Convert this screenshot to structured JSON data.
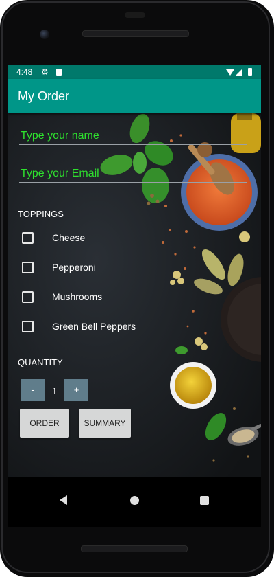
{
  "status_bar": {
    "time": "4:48",
    "icons": [
      "gear-icon",
      "sd-card-icon",
      "wifi-icon",
      "signal-icon",
      "battery-icon"
    ]
  },
  "app_bar": {
    "title": "My Order"
  },
  "form": {
    "name_placeholder": "Type your name",
    "email_placeholder": "Type your Email"
  },
  "toppings": {
    "heading": "TOPPINGS",
    "items": [
      {
        "label": "Cheese",
        "checked": false
      },
      {
        "label": "Pepperoni",
        "checked": false
      },
      {
        "label": "Mushrooms",
        "checked": false
      },
      {
        "label": "Green Bell Peppers",
        "checked": false
      }
    ]
  },
  "quantity": {
    "heading": "QUANTITY",
    "decrement_label": "-",
    "value": "1",
    "increment_label": "+"
  },
  "actions": {
    "order_label": "ORDER",
    "summary_label": "SUMMARY"
  },
  "colors": {
    "status_bar": "#00796b",
    "app_bar": "#009688",
    "placeholder_text": "#2ee02e",
    "stepper_button": "#607d8b",
    "action_button": "#d6d7d7"
  }
}
